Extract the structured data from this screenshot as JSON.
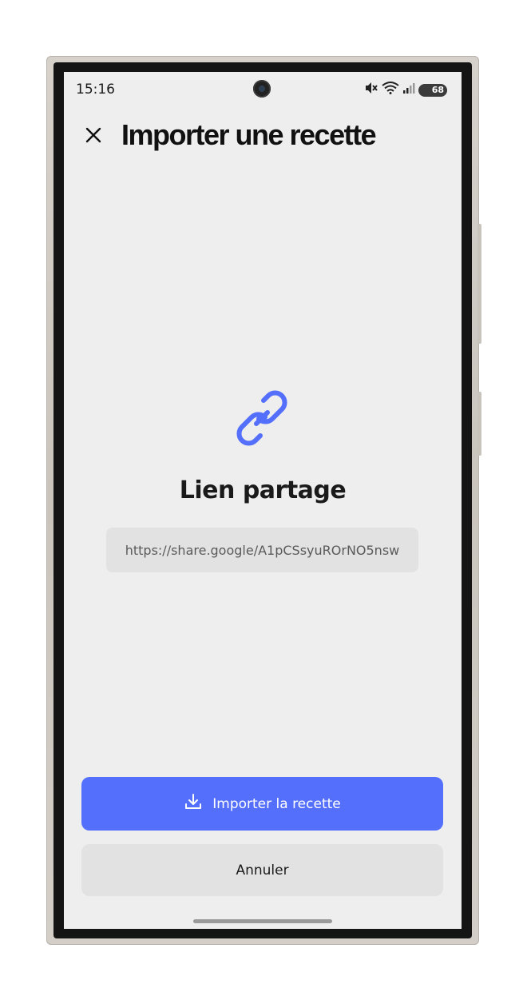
{
  "status_bar": {
    "time": "15:16",
    "battery_level": "68",
    "icons": [
      "mute-icon",
      "wifi-icon",
      "signal-icon",
      "battery-icon"
    ]
  },
  "header": {
    "title": "Importer une recette",
    "close_icon": "close-icon"
  },
  "main": {
    "icon": "link-icon",
    "title": "Lien partage",
    "url_value": "https://share.google/A1pCSsyuROrNO5nsw"
  },
  "actions": {
    "import_label": "Importer la recette",
    "import_icon": "download-icon",
    "cancel_label": "Annuler"
  },
  "colors": {
    "accent": "#546ffb",
    "background": "#eeeeee",
    "secondary_button": "#e2e2e2"
  }
}
